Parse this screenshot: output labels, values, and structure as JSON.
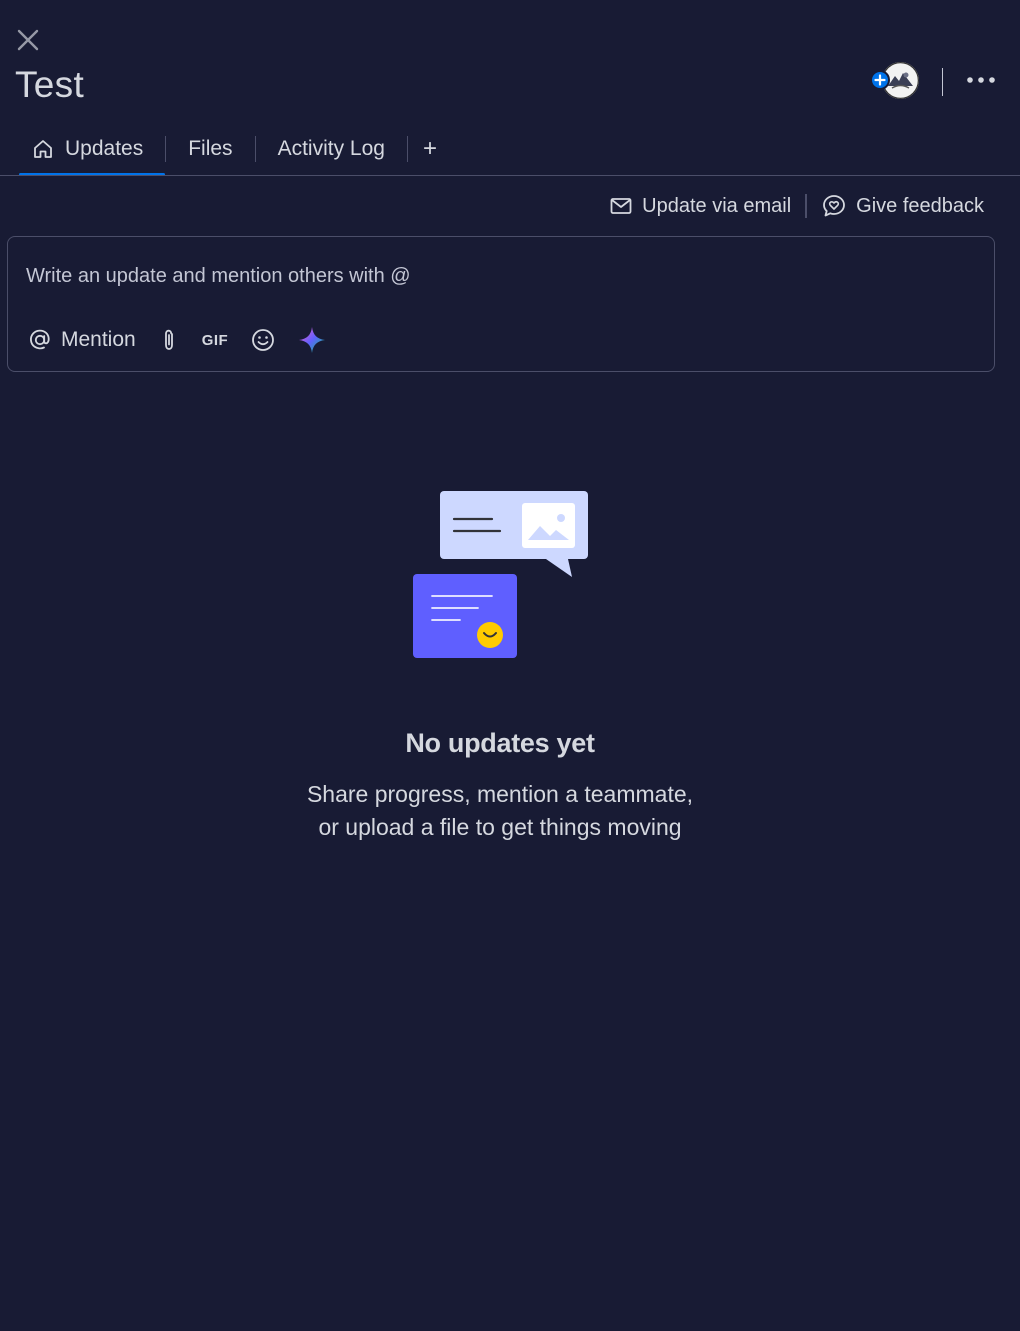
{
  "item": {
    "title": "Test"
  },
  "tabs": [
    {
      "label": "Updates",
      "icon": "home-icon",
      "active": true
    },
    {
      "label": "Files",
      "active": false
    },
    {
      "label": "Activity Log",
      "active": false
    }
  ],
  "add_tab_label": "+",
  "actions": {
    "email_label": "Update via email",
    "feedback_label": "Give feedback"
  },
  "composer": {
    "placeholder": "Write an update and mention others with @",
    "mention_label": "Mention",
    "gif_label": "GIF"
  },
  "empty_state": {
    "title": "No updates yet",
    "line1": "Share progress, mention a teammate,",
    "line2": "or upload a file to get things moving"
  },
  "colors": {
    "background": "#181b34",
    "accent": "#0073ea",
    "text": "#d5d8df",
    "border": "#4b4e69"
  }
}
